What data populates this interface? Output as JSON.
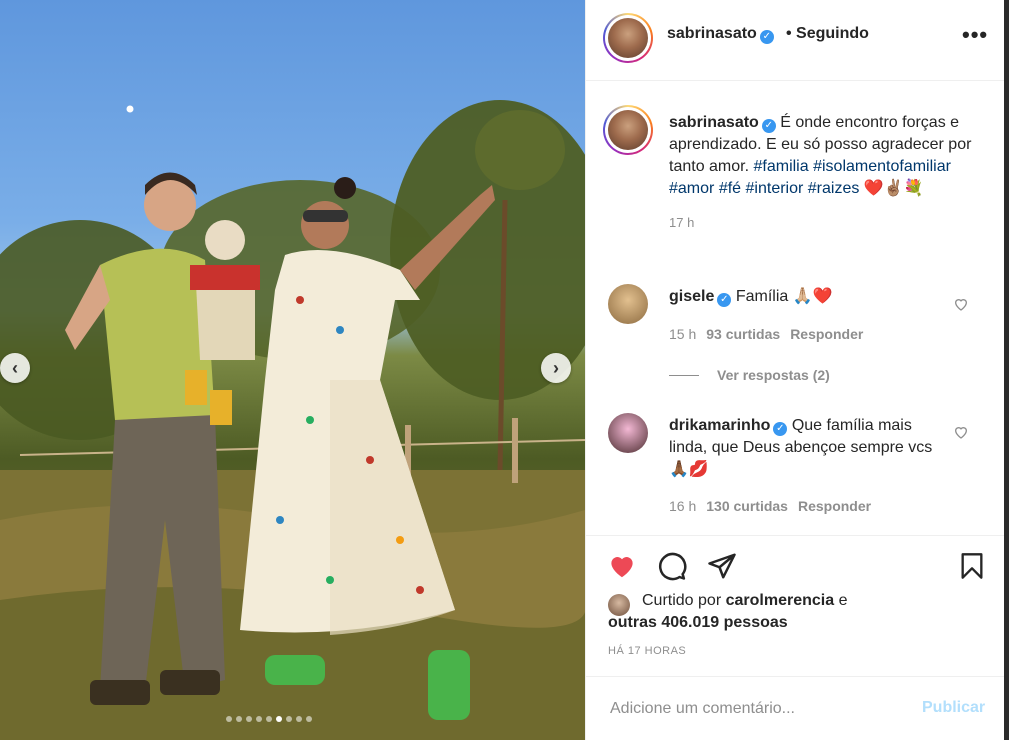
{
  "post": {
    "username": "sabrinasato",
    "follow_status": "• Seguindo",
    "more_icon": "more-horizontal-icon",
    "caption_text": "É onde encontro forças e aprendizado. E eu só posso agradecer por tanto amor.",
    "hashtags": [
      "#familia",
      "#isolamentofamiliar",
      "#amor",
      "#fé",
      "#interior",
      "#raizes"
    ],
    "caption_emojis": "❤️✌🏽💐",
    "caption_time": "17 h",
    "carousel": {
      "slide_count": 9,
      "active_index": 5
    }
  },
  "comments": [
    {
      "username": "gisele",
      "text": "Família 🙏🏼❤️",
      "time": "15 h",
      "likes": "93 curtidas",
      "reply": "Responder",
      "view_replies": "Ver respostas (2)"
    },
    {
      "username": "drikamarinho",
      "text": "Que família mais linda, que Deus abençoe sempre vcs 🙏🏾💋",
      "time": "16 h",
      "likes": "130 curtidas",
      "reply": "Responder"
    }
  ],
  "likes": {
    "liked_by_label": "Curtido por",
    "liked_by_user": "carolmerencia",
    "and_label": "e",
    "others": "outras 406.019 pessoas"
  },
  "timestamp": "HÁ 17 HORAS",
  "add_comment": {
    "placeholder": "Adicione um comentário...",
    "publish": "Publicar"
  },
  "colors": {
    "heart_red": "#ed4956",
    "link_blue": "#00376b",
    "verified_blue": "#3897f0",
    "publish_disabled": "#b2dffc"
  }
}
